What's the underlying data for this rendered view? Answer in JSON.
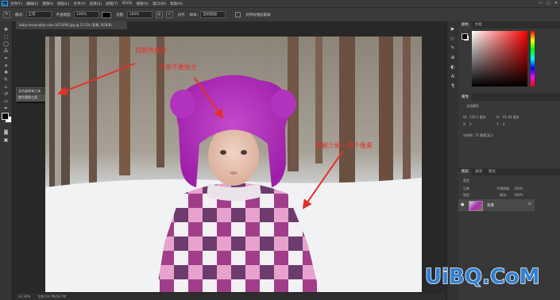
{
  "menubar": {
    "logo": "Ps",
    "items": [
      "文件(F)",
      "编辑(E)",
      "图像(I)",
      "图层(L)",
      "文字(Y)",
      "选择(S)",
      "滤镜(T)",
      "3D(D)",
      "视图(V)",
      "窗口(W)",
      "帮助(H)"
    ],
    "window_controls": [
      "—",
      "▢",
      "✕"
    ]
  },
  "options_bar": {
    "mode_label": "模式:",
    "mode_value": "正常",
    "opacity_label": "不透明度:",
    "opacity_value": "100%",
    "flow_label": "流量:",
    "flow_value": "100%",
    "align_label": "对齐",
    "sample_label": "样本:",
    "sample_value": "当前图层",
    "checkbox_label": "对所有图层取样"
  },
  "toolbar": {
    "tools": [
      "move-icon",
      "marquee-icon",
      "lasso-icon",
      "magic-wand-icon",
      "crop-icon",
      "eyedropper-icon",
      "healing-brush-icon",
      "brush-icon",
      "clone-stamp-icon",
      "history-brush-icon",
      "eraser-icon",
      "gradient-icon",
      "blur-icon",
      "dodge-icon",
      "pen-icon",
      "type-icon"
    ],
    "flyout": {
      "items": [
        {
          "label": "混合器画笔工具",
          "key": "B"
        },
        {
          "label": "颜色替换工具",
          "key": "B"
        }
      ]
    }
  },
  "document": {
    "tab_title": "baby-reasonably-cute-1071890.jpg @ 33.3% (背景, RGB/8)",
    "status_zoom": "33.33%",
    "status_info": "文档:16.7M/16.7M"
  },
  "annotations": {
    "top": "白颜色擦除",
    "middle": "毛发不要抠全",
    "right": "保留少留一两个像素"
  },
  "colors": {
    "annotation": "#e5302a",
    "hat": "#b42fbd",
    "watermark": "#2f7fd4"
  },
  "panels": {
    "color_tabs": [
      "颜色",
      "色板"
    ],
    "properties": {
      "tab": "属性",
      "title": "文档属性",
      "w_label": "W:",
      "w_value": "150.1 厘米",
      "h_label": "H:",
      "h_value": "91.44 厘米",
      "x_label": "X:",
      "x_value": "0",
      "y_label": "Y:",
      "y_value": "0",
      "resolution": "分辨率: 72 像素/英寸"
    },
    "layers": {
      "tabs": [
        "图层",
        "通道",
        "路径"
      ],
      "kind_label": "类型",
      "blend_mode": "正常",
      "opacity_label": "不透明度:",
      "opacity_value": "100%",
      "fill_label": "填充:",
      "fill_value": "100%",
      "lock_label": "锁定:",
      "layer_name": "背景"
    }
  },
  "watermark": "UiBQ.CoM"
}
